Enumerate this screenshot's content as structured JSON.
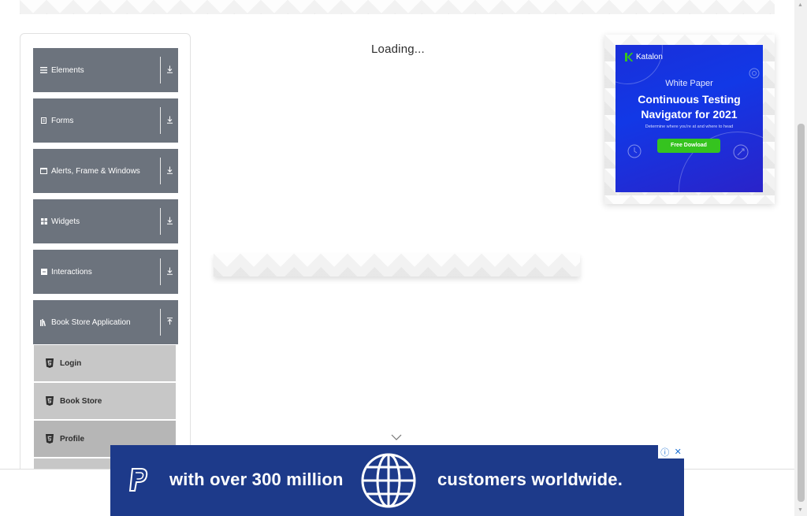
{
  "sidebar": {
    "groups": [
      {
        "label": "Elements",
        "icon": "hamburger-icon",
        "arrow": "download-arrow-icon"
      },
      {
        "label": "Forms",
        "icon": "form-icon",
        "arrow": "download-arrow-icon"
      },
      {
        "label": "Alerts, Frame & Windows",
        "icon": "window-icon",
        "arrow": "download-arrow-icon"
      },
      {
        "label": "Widgets",
        "icon": "grid-icon",
        "arrow": "download-arrow-icon"
      },
      {
        "label": "Interactions",
        "icon": "interaction-icon",
        "arrow": "download-arrow-icon"
      },
      {
        "label": "Book Store Application",
        "icon": "books-icon",
        "arrow": "upload-arrow-icon"
      }
    ],
    "sub_items": [
      {
        "label": "Login"
      },
      {
        "label": "Book Store"
      },
      {
        "label": "Profile"
      }
    ]
  },
  "main": {
    "loading_text": "Loading..."
  },
  "right_ad": {
    "brand": "Katalon",
    "kicker": "White Paper",
    "title_line1": "Continuous Testing",
    "title_line2": "Navigator for 2021",
    "subtitle": "Determine where you're at and where to head",
    "button": "Free Dowload"
  },
  "bottom_ad": {
    "text_left": "with over 300 million",
    "text_right": "customers worldwide."
  },
  "colors": {
    "sidebar_header": "#6c737d",
    "sub_item": "#c7c7c7",
    "sub_item_active": "#b6b6b6",
    "ad_blue": "#1238e6",
    "ad_green": "#35c31f",
    "paypal_blue": "#1d3a8a"
  }
}
